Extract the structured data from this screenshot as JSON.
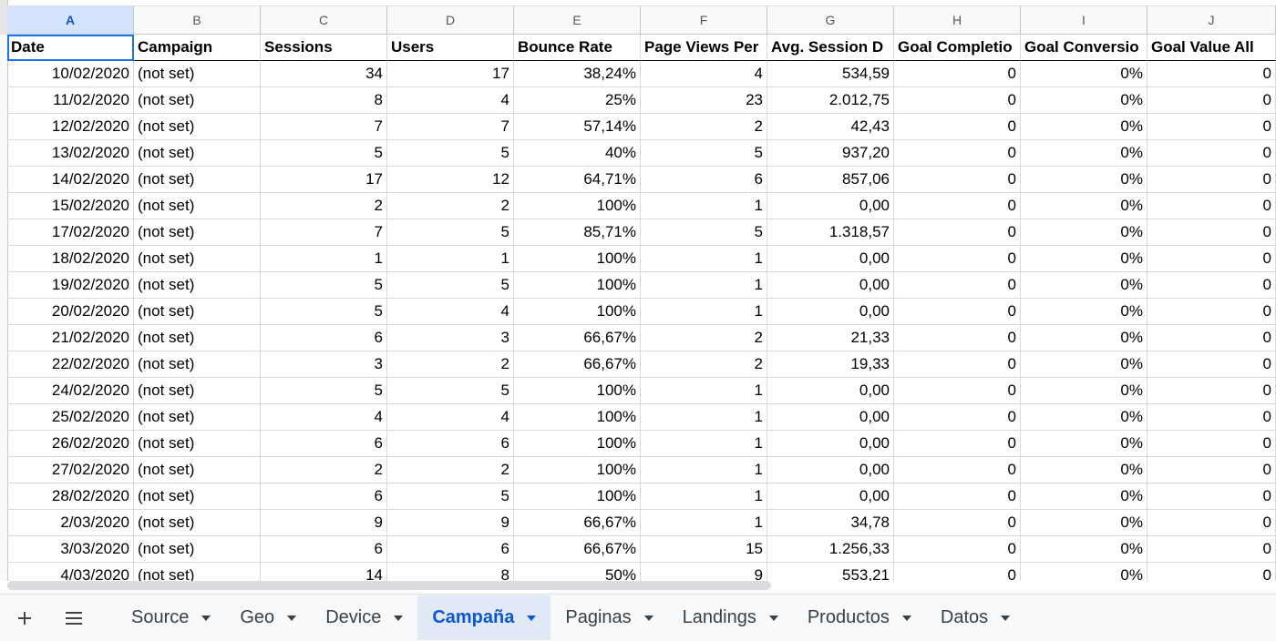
{
  "columns": [
    {
      "letter": "A",
      "width": 139,
      "align": "num"
    },
    {
      "letter": "B",
      "width": 139,
      "align": "text"
    },
    {
      "letter": "C",
      "width": 139,
      "align": "num"
    },
    {
      "letter": "D",
      "width": 139,
      "align": "num"
    },
    {
      "letter": "E",
      "width": 139,
      "align": "num"
    },
    {
      "letter": "F",
      "width": 139,
      "align": "num"
    },
    {
      "letter": "G",
      "width": 139,
      "align": "num"
    },
    {
      "letter": "H",
      "width": 139,
      "align": "num"
    },
    {
      "letter": "I",
      "width": 139,
      "align": "num"
    },
    {
      "letter": "J",
      "width": 141,
      "align": "num"
    }
  ],
  "headers": [
    "Date",
    "Campaign",
    "Sessions",
    "Users",
    "Bounce Rate",
    "Page Views Per",
    "Avg. Session D",
    "Goal Completio",
    "Goal Conversio",
    "Goal Value All"
  ],
  "rows": [
    [
      "10/02/2020",
      "(not set)",
      "34",
      "17",
      "38,24%",
      "4",
      "534,59",
      "0",
      "0%",
      "0"
    ],
    [
      "11/02/2020",
      "(not set)",
      "8",
      "4",
      "25%",
      "23",
      "2.012,75",
      "0",
      "0%",
      "0"
    ],
    [
      "12/02/2020",
      "(not set)",
      "7",
      "7",
      "57,14%",
      "2",
      "42,43",
      "0",
      "0%",
      "0"
    ],
    [
      "13/02/2020",
      "(not set)",
      "5",
      "5",
      "40%",
      "5",
      "937,20",
      "0",
      "0%",
      "0"
    ],
    [
      "14/02/2020",
      "(not set)",
      "17",
      "12",
      "64,71%",
      "6",
      "857,06",
      "0",
      "0%",
      "0"
    ],
    [
      "15/02/2020",
      "(not set)",
      "2",
      "2",
      "100%",
      "1",
      "0,00",
      "0",
      "0%",
      "0"
    ],
    [
      "17/02/2020",
      "(not set)",
      "7",
      "5",
      "85,71%",
      "5",
      "1.318,57",
      "0",
      "0%",
      "0"
    ],
    [
      "18/02/2020",
      "(not set)",
      "1",
      "1",
      "100%",
      "1",
      "0,00",
      "0",
      "0%",
      "0"
    ],
    [
      "19/02/2020",
      "(not set)",
      "5",
      "5",
      "100%",
      "1",
      "0,00",
      "0",
      "0%",
      "0"
    ],
    [
      "20/02/2020",
      "(not set)",
      "5",
      "4",
      "100%",
      "1",
      "0,00",
      "0",
      "0%",
      "0"
    ],
    [
      "21/02/2020",
      "(not set)",
      "6",
      "3",
      "66,67%",
      "2",
      "21,33",
      "0",
      "0%",
      "0"
    ],
    [
      "22/02/2020",
      "(not set)",
      "3",
      "2",
      "66,67%",
      "2",
      "19,33",
      "0",
      "0%",
      "0"
    ],
    [
      "24/02/2020",
      "(not set)",
      "5",
      "5",
      "100%",
      "1",
      "0,00",
      "0",
      "0%",
      "0"
    ],
    [
      "25/02/2020",
      "(not set)",
      "4",
      "4",
      "100%",
      "1",
      "0,00",
      "0",
      "0%",
      "0"
    ],
    [
      "26/02/2020",
      "(not set)",
      "6",
      "6",
      "100%",
      "1",
      "0,00",
      "0",
      "0%",
      "0"
    ],
    [
      "27/02/2020",
      "(not set)",
      "2",
      "2",
      "100%",
      "1",
      "0,00",
      "0",
      "0%",
      "0"
    ],
    [
      "28/02/2020",
      "(not set)",
      "6",
      "5",
      "100%",
      "1",
      "0,00",
      "0",
      "0%",
      "0"
    ],
    [
      "2/03/2020",
      "(not set)",
      "9",
      "9",
      "66,67%",
      "1",
      "34,78",
      "0",
      "0%",
      "0"
    ],
    [
      "3/03/2020",
      "(not set)",
      "6",
      "6",
      "66,67%",
      "15",
      "1.256,33",
      "0",
      "0%",
      "0"
    ],
    [
      "4/03/2020",
      "(not set)",
      "14",
      "8",
      "50%",
      "9",
      "553,21",
      "0",
      "0%",
      "0"
    ]
  ],
  "tabs": [
    {
      "label": "Source",
      "active": false
    },
    {
      "label": "Geo",
      "active": false
    },
    {
      "label": "Device",
      "active": false
    },
    {
      "label": "Campaña",
      "active": true
    },
    {
      "label": "Paginas",
      "active": false
    },
    {
      "label": "Landings",
      "active": false
    },
    {
      "label": "Productos",
      "active": false
    },
    {
      "label": "Datos",
      "active": false
    }
  ],
  "icons": {
    "add": "plus-icon",
    "list": "menu-icon"
  },
  "colors": {
    "accent": "#0b57d0",
    "selected_header": "#d3e3fd",
    "active_tab": "#e1e9f7"
  }
}
